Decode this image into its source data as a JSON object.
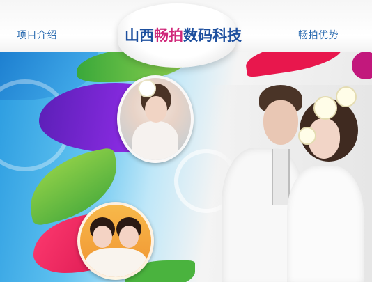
{
  "nav": {
    "left_label": "项目介绍",
    "right_label": "畅拍优势"
  },
  "logo": {
    "part1": "山西",
    "part2": "畅拍",
    "part3": "数码科技"
  },
  "colors": {
    "nav_link": "#2a6bb0",
    "logo_blue": "#1d4f9e",
    "logo_pink": "#d0287a"
  },
  "banner": {
    "photos": [
      {
        "name": "portrait-bride-flowers"
      },
      {
        "name": "portrait-two-girls-bunny-ears"
      },
      {
        "name": "couple-wedding-photo"
      }
    ]
  }
}
